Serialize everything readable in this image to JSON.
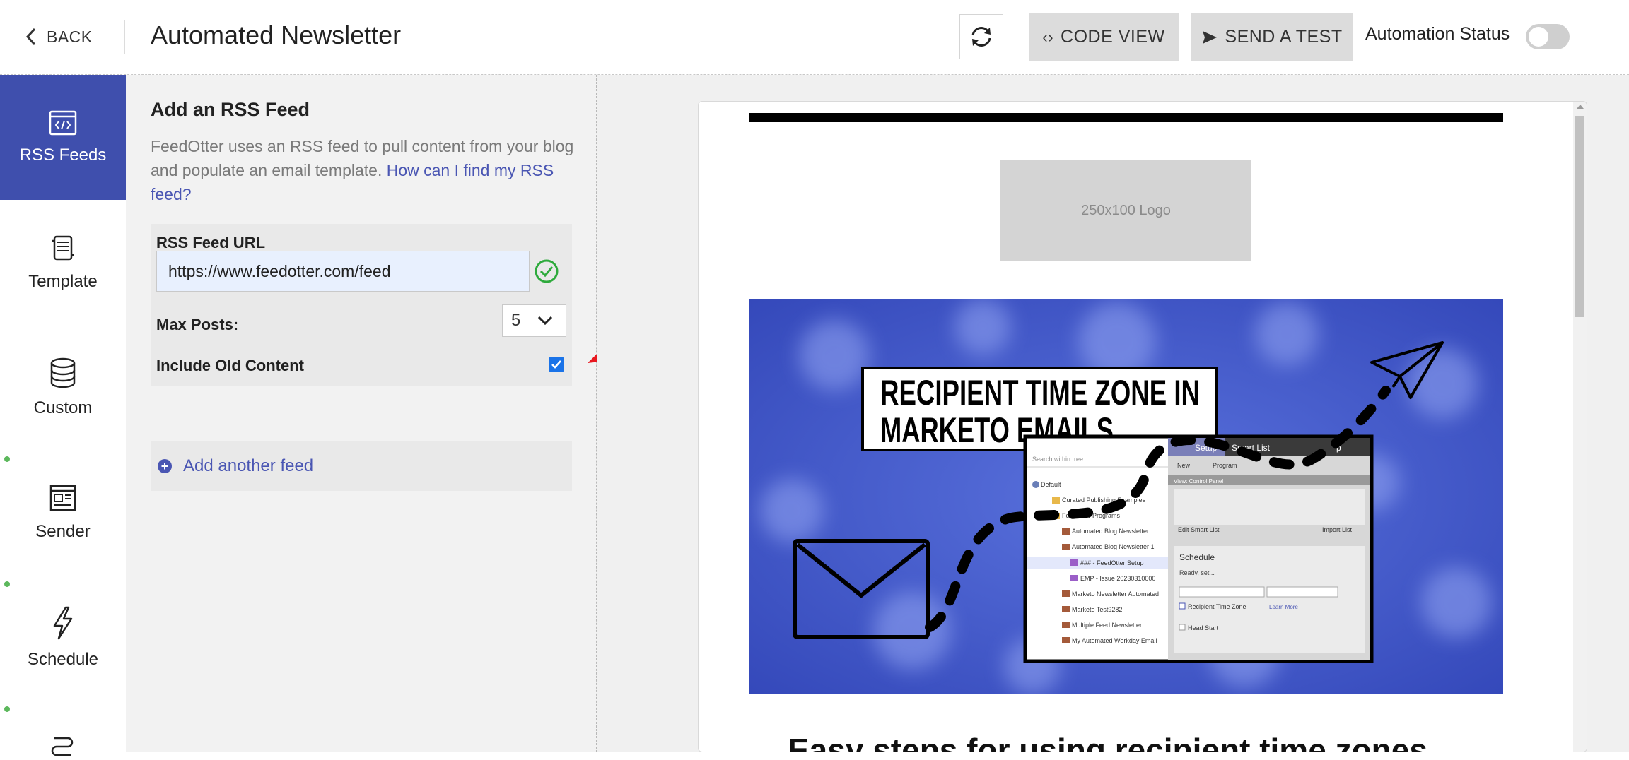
{
  "header": {
    "back_label": "BACK",
    "title": "Automated Newsletter",
    "refresh_icon": "refresh-icon",
    "code_view_label": "CODE VIEW",
    "send_test_label": "SEND A TEST",
    "automation_status_label": "Automation Status",
    "automation_enabled": false
  },
  "sidebar": {
    "items": [
      {
        "label": "RSS Feeds",
        "icon": "code-window-icon",
        "active": true
      },
      {
        "label": "Template",
        "icon": "template-icon",
        "active": false
      },
      {
        "label": "Custom",
        "icon": "database-icon",
        "active": false
      },
      {
        "label": "Sender",
        "icon": "newspaper-icon",
        "active": false
      },
      {
        "label": "Schedule",
        "icon": "lightning-icon",
        "active": false
      }
    ],
    "accent_color": "#3f4fad",
    "status_dot_color": "#5cb85c"
  },
  "panel": {
    "title": "Add an RSS Feed",
    "description": "FeedOtter uses an RSS feed to pull content from your blog and populate an email template.",
    "help_link": "How can I find my RSS feed?",
    "feed_url_label": "RSS Feed URL",
    "feed_url_value": "https://www.feedotter.com/feed",
    "max_posts_label": "Max Posts:",
    "max_posts_value": "5",
    "include_old_label": "Include Old Content",
    "include_old_checked": true,
    "add_feed_label": "Add another feed"
  },
  "preview": {
    "logo_placeholder": "250x100 Logo",
    "hero_title_line1": "RECIPIENT TIME ZONE IN",
    "hero_title_line2": "MARKETO EMAILS",
    "hero_bg_color": "#4a5fd0",
    "heading": "Easy steps for using recipient time zones",
    "mock_app": {
      "tabs": [
        "Setup",
        "Smart List",
        "p"
      ],
      "search_placeholder": "Search within tree",
      "tree": [
        "Default",
        "Curated Publishing Examples",
        "FeedOtter Programs",
        "Automated Blog Newsletter",
        "Automated Blog Newsletter 1",
        "### - FeedOtter Setup",
        "EMP - Issue 20230310000",
        "Marketo Newsletter Automated",
        "Marketo Test9282",
        "Multiple Feed Newsletter",
        "My Automated Workday Email"
      ],
      "view_label": "View: Control Panel",
      "edit_smart_list": "Edit Smart List",
      "import_list": "Import List",
      "schedule_title": "Schedule",
      "ready_text": "Ready, set...",
      "recipient_tz": "Recipient Time Zone",
      "learn_more": "Learn More",
      "head_start": "Head Start",
      "new_label": "New",
      "program_label": "Program"
    }
  }
}
